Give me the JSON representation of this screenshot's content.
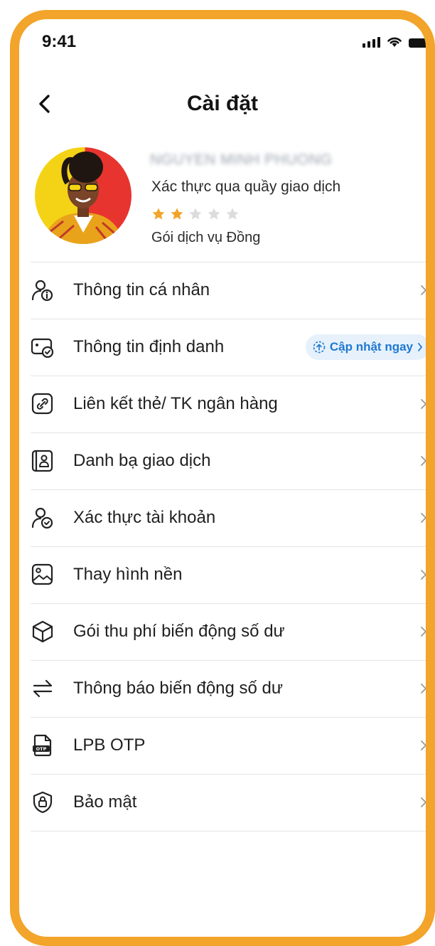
{
  "status_bar": {
    "time": "9:41"
  },
  "header": {
    "title": "Cài đặt"
  },
  "profile": {
    "name": "NGUYEN MINH PHUONG",
    "verification": "Xác thực qua quầy giao dịch",
    "rating": 2,
    "rating_max": 5,
    "package": "Gói dịch vụ Đồng"
  },
  "menu": [
    {
      "label": "Thông tin cá nhân",
      "icon": "user-info-icon"
    },
    {
      "label": "Thông tin định danh",
      "icon": "id-card-icon",
      "badge": "Cập nhật ngay"
    },
    {
      "label": "Liên kết thẻ/ TK ngân hàng",
      "icon": "link-icon"
    },
    {
      "label": "Danh bạ giao dịch",
      "icon": "contacts-icon"
    },
    {
      "label": "Xác thực tài khoản",
      "icon": "user-check-icon"
    },
    {
      "label": "Thay hình nền",
      "icon": "image-icon"
    },
    {
      "label": "Gói thu phí biến động số dư",
      "icon": "box-icon"
    },
    {
      "label": "Thông báo biến động số dư",
      "icon": "swap-icon"
    },
    {
      "label": "LPB OTP",
      "icon": "otp-icon"
    },
    {
      "label": "Bảo mật",
      "icon": "shield-lock-icon"
    }
  ],
  "colors": {
    "accent": "#f2a42b",
    "badge_text": "#1f78d1",
    "badge_bg": "#e6f1fc",
    "star": "#f2a42b",
    "star_empty": "#dcdcdc"
  }
}
